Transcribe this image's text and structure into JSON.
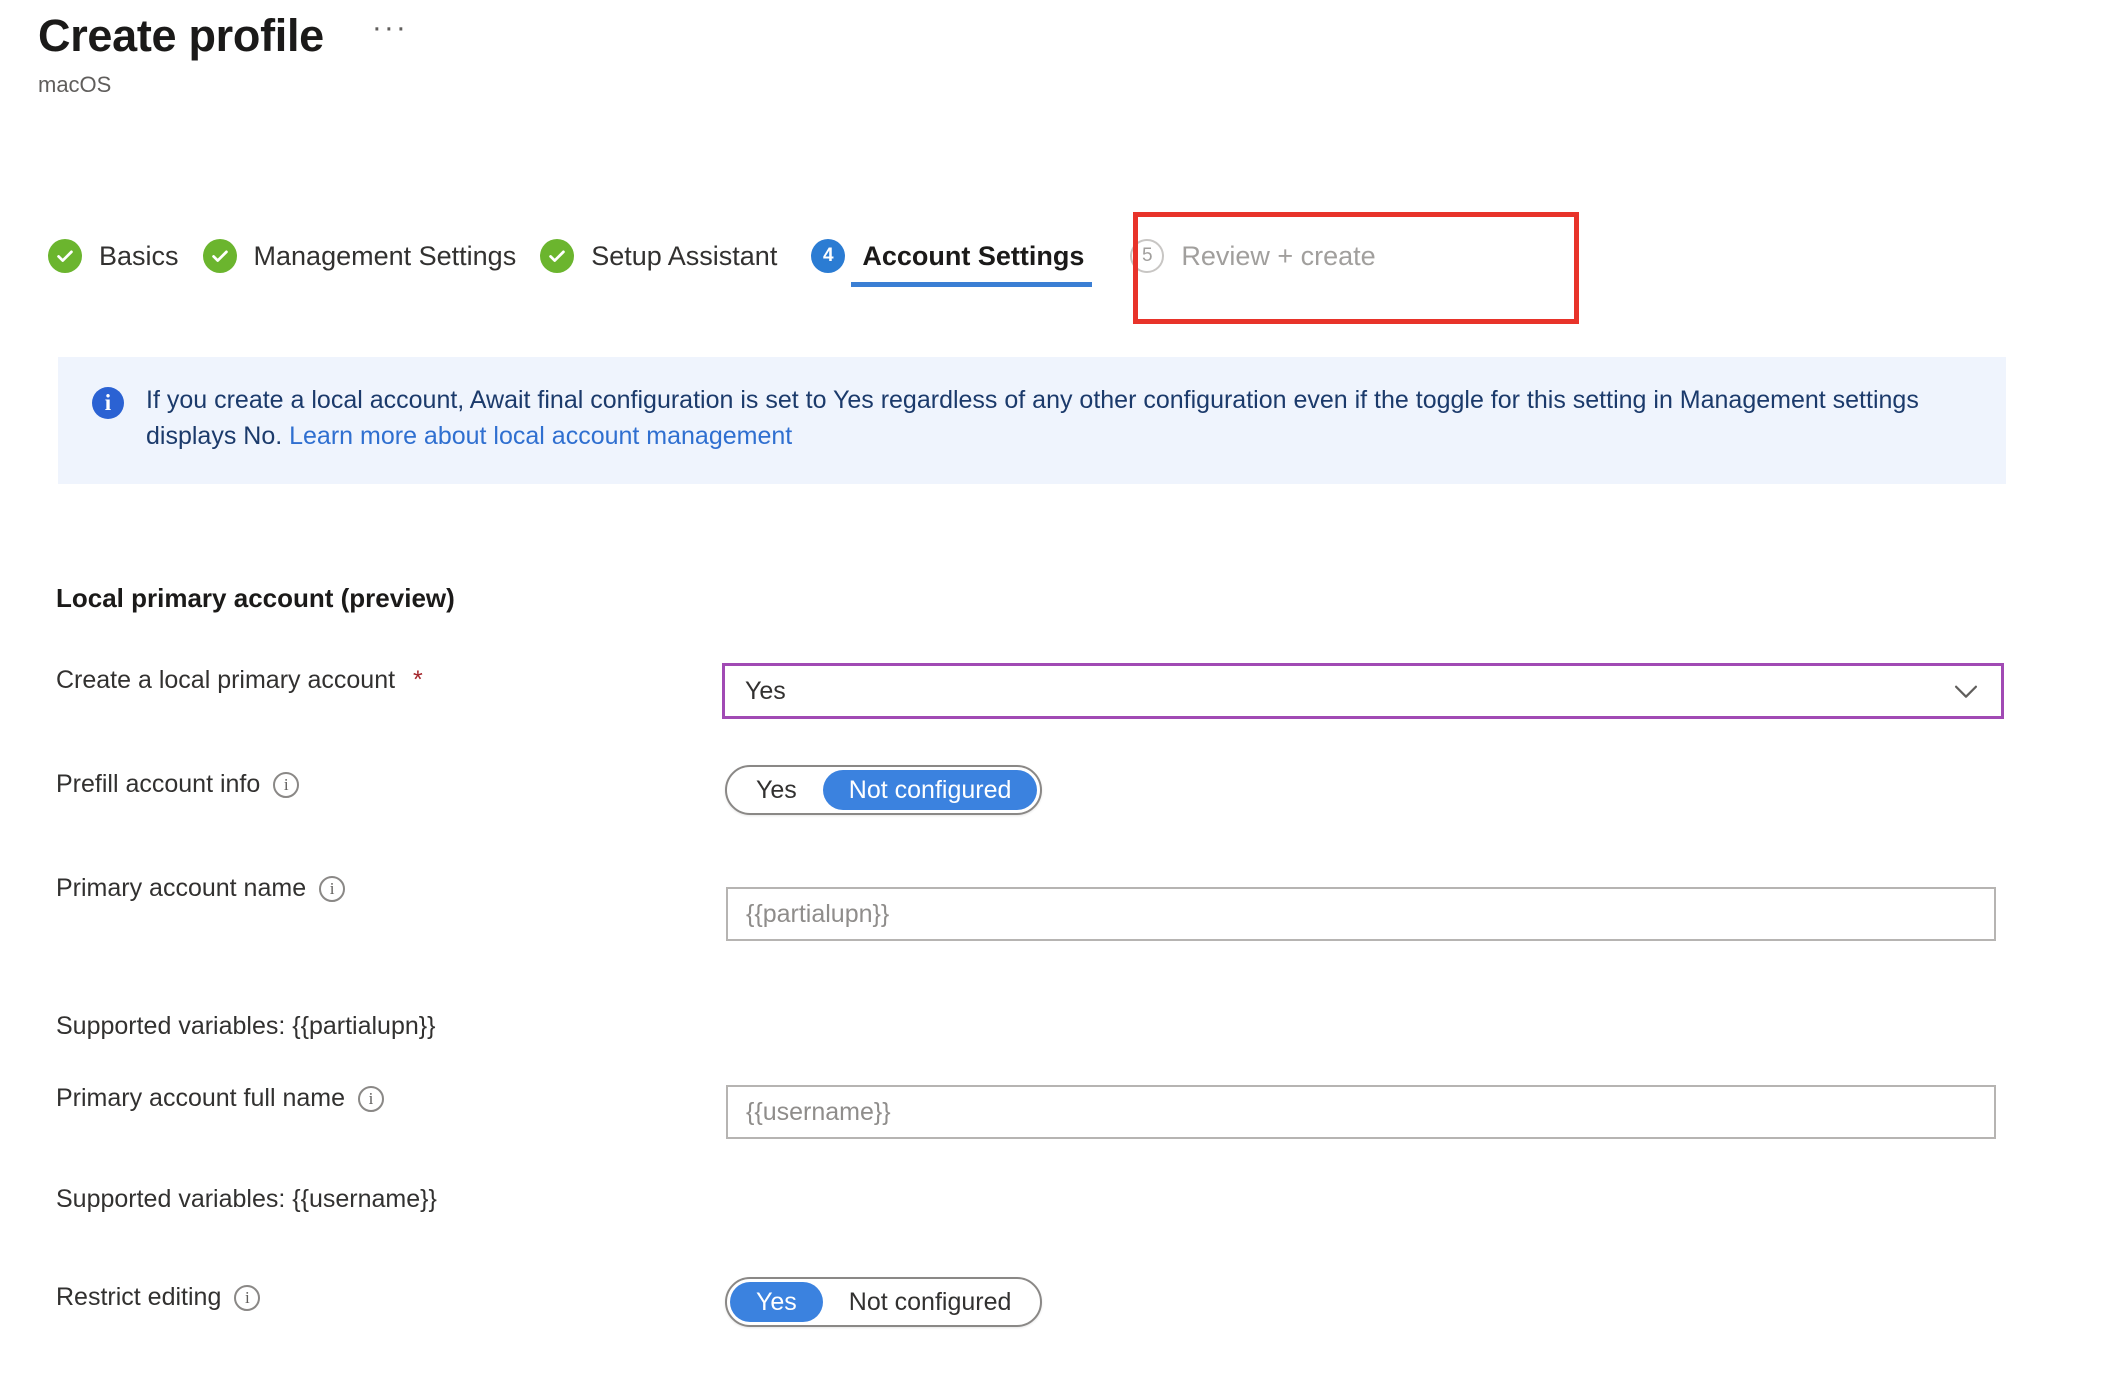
{
  "header": {
    "title": "Create profile",
    "subtitle": "macOS",
    "more_label": "···"
  },
  "wizard": {
    "steps": [
      {
        "label": "Basics",
        "state": "done",
        "badge": "check"
      },
      {
        "label": "Management Settings",
        "state": "done",
        "badge": "check"
      },
      {
        "label": "Setup Assistant",
        "state": "done",
        "badge": "check"
      },
      {
        "label": "Account Settings",
        "state": "active",
        "badge": "4"
      },
      {
        "label": "Review + create",
        "state": "disabled",
        "badge": "5"
      }
    ],
    "highlight_color": "#e8332a",
    "active_color": "#2b7cd3",
    "done_color": "#6bb52e"
  },
  "banner": {
    "icon": "info-icon",
    "text_before_link": "If you create a local account, Await final configuration is set to Yes regardless of any other configuration even if the toggle for this setting in Management settings displays No. ",
    "link_text": "Learn more about local account management",
    "background": "#eff4fd"
  },
  "section": {
    "heading": "Local primary account (preview)"
  },
  "fields": {
    "create_local_primary_account": {
      "label": "Create a local primary account",
      "required_marker": "*",
      "value": "Yes",
      "border_color": "#a14ab4"
    },
    "prefill_account_info": {
      "label": "Prefill account info",
      "options": [
        "Yes",
        "Not configured"
      ],
      "selected": "Not configured"
    },
    "primary_account_name": {
      "label": "Primary account name",
      "value": "{{partialupn}}",
      "helper": "Supported variables: {{partialupn}}"
    },
    "primary_account_full_name": {
      "label": "Primary account full name",
      "value": "{{username}}",
      "helper": "Supported variables: {{username}}"
    },
    "restrict_editing": {
      "label": "Restrict editing",
      "options": [
        "Yes",
        "Not configured"
      ],
      "selected": "Yes"
    }
  }
}
